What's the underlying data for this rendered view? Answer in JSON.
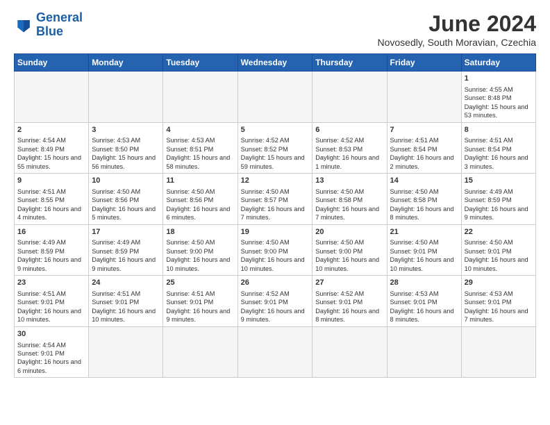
{
  "logo": {
    "text_general": "General",
    "text_blue": "Blue"
  },
  "header": {
    "month_year": "June 2024",
    "location": "Novosedly, South Moravian, Czechia"
  },
  "weekdays": [
    "Sunday",
    "Monday",
    "Tuesday",
    "Wednesday",
    "Thursday",
    "Friday",
    "Saturday"
  ],
  "weeks": [
    [
      {
        "day": "",
        "info": ""
      },
      {
        "day": "",
        "info": ""
      },
      {
        "day": "",
        "info": ""
      },
      {
        "day": "",
        "info": ""
      },
      {
        "day": "",
        "info": ""
      },
      {
        "day": "",
        "info": ""
      },
      {
        "day": "1",
        "info": "Sunrise: 4:55 AM\nSunset: 8:48 PM\nDaylight: 15 hours and 53 minutes."
      }
    ],
    [
      {
        "day": "2",
        "info": "Sunrise: 4:54 AM\nSunset: 8:49 PM\nDaylight: 15 hours and 55 minutes."
      },
      {
        "day": "3",
        "info": "Sunrise: 4:53 AM\nSunset: 8:50 PM\nDaylight: 15 hours and 56 minutes."
      },
      {
        "day": "4",
        "info": "Sunrise: 4:53 AM\nSunset: 8:51 PM\nDaylight: 15 hours and 58 minutes."
      },
      {
        "day": "5",
        "info": "Sunrise: 4:52 AM\nSunset: 8:52 PM\nDaylight: 15 hours and 59 minutes."
      },
      {
        "day": "6",
        "info": "Sunrise: 4:52 AM\nSunset: 8:53 PM\nDaylight: 16 hours and 1 minute."
      },
      {
        "day": "7",
        "info": "Sunrise: 4:51 AM\nSunset: 8:54 PM\nDaylight: 16 hours and 2 minutes."
      },
      {
        "day": "8",
        "info": "Sunrise: 4:51 AM\nSunset: 8:54 PM\nDaylight: 16 hours and 3 minutes."
      }
    ],
    [
      {
        "day": "9",
        "info": "Sunrise: 4:51 AM\nSunset: 8:55 PM\nDaylight: 16 hours and 4 minutes."
      },
      {
        "day": "10",
        "info": "Sunrise: 4:50 AM\nSunset: 8:56 PM\nDaylight: 16 hours and 5 minutes."
      },
      {
        "day": "11",
        "info": "Sunrise: 4:50 AM\nSunset: 8:56 PM\nDaylight: 16 hours and 6 minutes."
      },
      {
        "day": "12",
        "info": "Sunrise: 4:50 AM\nSunset: 8:57 PM\nDaylight: 16 hours and 7 minutes."
      },
      {
        "day": "13",
        "info": "Sunrise: 4:50 AM\nSunset: 8:58 PM\nDaylight: 16 hours and 7 minutes."
      },
      {
        "day": "14",
        "info": "Sunrise: 4:50 AM\nSunset: 8:58 PM\nDaylight: 16 hours and 8 minutes."
      },
      {
        "day": "15",
        "info": "Sunrise: 4:49 AM\nSunset: 8:59 PM\nDaylight: 16 hours and 9 minutes."
      }
    ],
    [
      {
        "day": "16",
        "info": "Sunrise: 4:49 AM\nSunset: 8:59 PM\nDaylight: 16 hours and 9 minutes."
      },
      {
        "day": "17",
        "info": "Sunrise: 4:49 AM\nSunset: 8:59 PM\nDaylight: 16 hours and 9 minutes."
      },
      {
        "day": "18",
        "info": "Sunrise: 4:50 AM\nSunset: 9:00 PM\nDaylight: 16 hours and 10 minutes."
      },
      {
        "day": "19",
        "info": "Sunrise: 4:50 AM\nSunset: 9:00 PM\nDaylight: 16 hours and 10 minutes."
      },
      {
        "day": "20",
        "info": "Sunrise: 4:50 AM\nSunset: 9:00 PM\nDaylight: 16 hours and 10 minutes."
      },
      {
        "day": "21",
        "info": "Sunrise: 4:50 AM\nSunset: 9:01 PM\nDaylight: 16 hours and 10 minutes."
      },
      {
        "day": "22",
        "info": "Sunrise: 4:50 AM\nSunset: 9:01 PM\nDaylight: 16 hours and 10 minutes."
      }
    ],
    [
      {
        "day": "23",
        "info": "Sunrise: 4:51 AM\nSunset: 9:01 PM\nDaylight: 16 hours and 10 minutes."
      },
      {
        "day": "24",
        "info": "Sunrise: 4:51 AM\nSunset: 9:01 PM\nDaylight: 16 hours and 10 minutes."
      },
      {
        "day": "25",
        "info": "Sunrise: 4:51 AM\nSunset: 9:01 PM\nDaylight: 16 hours and 9 minutes."
      },
      {
        "day": "26",
        "info": "Sunrise: 4:52 AM\nSunset: 9:01 PM\nDaylight: 16 hours and 9 minutes."
      },
      {
        "day": "27",
        "info": "Sunrise: 4:52 AM\nSunset: 9:01 PM\nDaylight: 16 hours and 8 minutes."
      },
      {
        "day": "28",
        "info": "Sunrise: 4:53 AM\nSunset: 9:01 PM\nDaylight: 16 hours and 8 minutes."
      },
      {
        "day": "29",
        "info": "Sunrise: 4:53 AM\nSunset: 9:01 PM\nDaylight: 16 hours and 7 minutes."
      }
    ],
    [
      {
        "day": "30",
        "info": "Sunrise: 4:54 AM\nSunset: 9:01 PM\nDaylight: 16 hours and 6 minutes."
      },
      {
        "day": "",
        "info": ""
      },
      {
        "day": "",
        "info": ""
      },
      {
        "day": "",
        "info": ""
      },
      {
        "day": "",
        "info": ""
      },
      {
        "day": "",
        "info": ""
      },
      {
        "day": "",
        "info": ""
      }
    ]
  ]
}
